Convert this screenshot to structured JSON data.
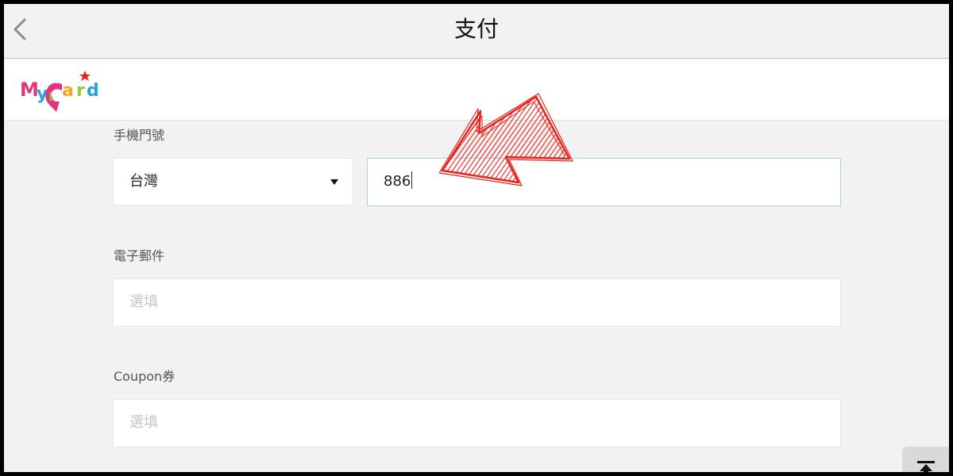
{
  "header": {
    "title": "支付",
    "back_icon": "chevron-left-icon"
  },
  "brand": {
    "logo_text": "MyCard",
    "icon": "mycard-logo"
  },
  "form": {
    "phone": {
      "label": "手機門號",
      "country_value": "台灣",
      "country_icon": "caret-down-icon",
      "number_value": "886"
    },
    "email": {
      "label": "電子郵件",
      "placeholder": "選填"
    },
    "coupon": {
      "label": "Coupon券",
      "placeholder": "選填"
    }
  },
  "annotation": {
    "icon": "red-hand-drawn-arrow",
    "color": "#e8231b"
  },
  "controls": {
    "scroll_top_icon": "scroll-to-top-icon"
  }
}
